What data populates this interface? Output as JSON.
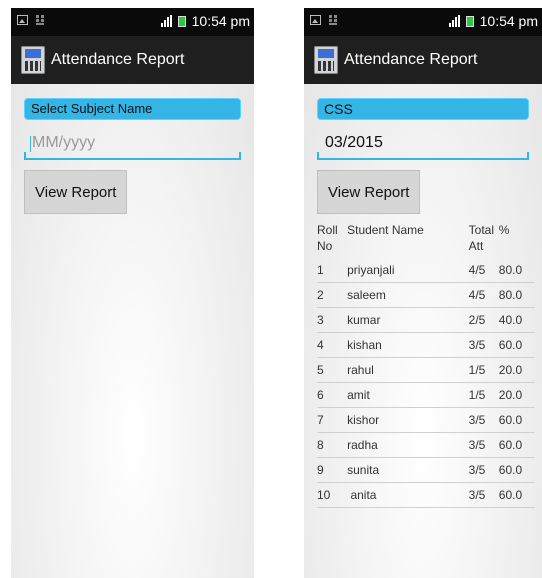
{
  "statusbar": {
    "time": "10:54 pm"
  },
  "actionbar": {
    "title": "Attendance Report"
  },
  "left": {
    "subject_label": "Select Subject Name",
    "date_placeholder": "MM/yyyy",
    "button_label": "View Report"
  },
  "right": {
    "subject_selected": "CSS",
    "date_value": "03/2015",
    "button_label": "View Report",
    "table": {
      "headers": [
        "Roll No",
        "Student Name",
        "Total Att",
        "%"
      ],
      "rows": [
        [
          "1",
          "priyanjali",
          "4/5",
          "80.0"
        ],
        [
          "2",
          "saleem",
          "4/5",
          "80.0"
        ],
        [
          "3",
          "kumar",
          "2/5",
          "40.0"
        ],
        [
          "4",
          "kishan",
          "3/5",
          "60.0"
        ],
        [
          "5",
          "rahul",
          "1/5",
          "20.0"
        ],
        [
          "6",
          "amit",
          "1/5",
          "20.0"
        ],
        [
          "7",
          "kishor",
          "3/5",
          "60.0"
        ],
        [
          "8",
          "radha",
          "3/5",
          "60.0"
        ],
        [
          "9",
          "sunita",
          "3/5",
          "60.0"
        ],
        [
          "10",
          " anita",
          "3/5",
          "60.0"
        ]
      ]
    }
  },
  "colors": {
    "accent": "#33b5e5",
    "actionbar": "#1f1f1f",
    "statusbar": "#0a0a0a"
  },
  "icons": {
    "app": "phone-app-icon",
    "status": [
      "image-notification-icon",
      "sim-icon",
      "signal-icon",
      "battery-icon"
    ]
  }
}
